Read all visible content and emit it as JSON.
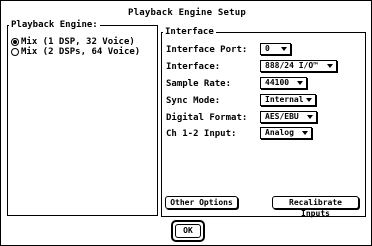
{
  "dialog": {
    "title": "Playback Engine Setup"
  },
  "engine": {
    "group_label": "Playback Engine:",
    "options": [
      {
        "label": "Mix (1 DSP, 32 Voice)",
        "selected": true
      },
      {
        "label": "Mix (2 DSPs, 64 Voice)",
        "selected": false
      }
    ]
  },
  "interface": {
    "group_label": "Interface",
    "fields": [
      {
        "label": "Interface Port:",
        "value": "0"
      },
      {
        "label": "Interface:",
        "value": "888/24 I/O™"
      },
      {
        "label": "Sample Rate:",
        "value": "44100"
      },
      {
        "label": "Sync Mode:",
        "value": "Internal"
      },
      {
        "label": "Digital Format:",
        "value": "AES/EBU"
      },
      {
        "label": "Ch 1-2 Input:",
        "value": "Analog"
      }
    ]
  },
  "buttons": {
    "other_options": "Other Options",
    "recalibrate_inputs": "Recalibrate Inputs",
    "ok": "OK"
  }
}
